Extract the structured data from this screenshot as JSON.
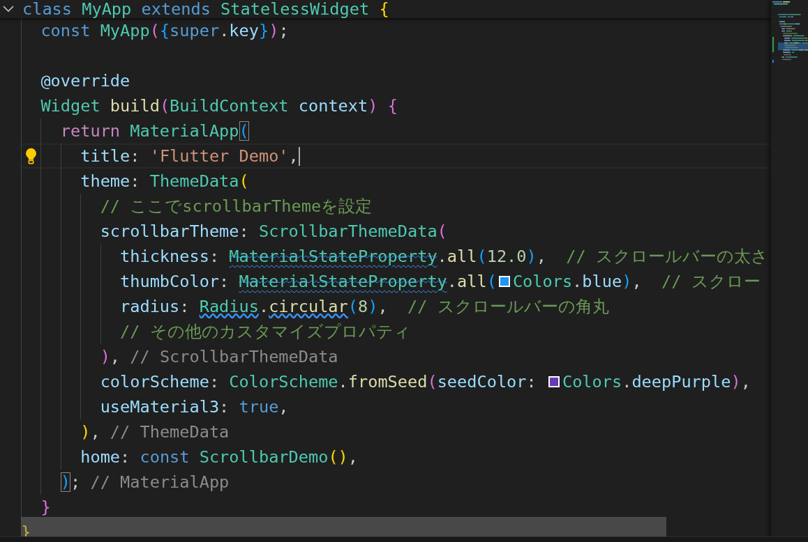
{
  "sticky_line": {
    "expanded": true,
    "tokens": [
      {
        "text": "class ",
        "kind": "kw"
      },
      {
        "text": "MyApp ",
        "kind": "type"
      },
      {
        "text": "extends ",
        "kind": "kw"
      },
      {
        "text": "StatelessWidget ",
        "kind": "type"
      },
      {
        "text": "{",
        "kind": "br1"
      }
    ]
  },
  "lines": [
    {
      "tokens": [
        {
          "text": "const ",
          "kind": "kw"
        },
        {
          "text": "MyApp",
          "kind": "type"
        },
        {
          "text": "(",
          "kind": "br2"
        },
        {
          "text": "{",
          "kind": "br3"
        },
        {
          "text": "super",
          "kind": "kw"
        },
        {
          "text": ".",
          "kind": "punct"
        },
        {
          "text": "key",
          "kind": "var"
        },
        {
          "text": "}",
          "kind": "br3"
        },
        {
          "text": ")",
          "kind": "br2"
        },
        {
          "text": ";",
          "kind": "punct"
        }
      ]
    },
    {
      "kind": "blank"
    },
    {
      "tokens": [
        {
          "text": "@override",
          "kind": "var"
        }
      ]
    },
    {
      "tokens": [
        {
          "text": "Widget ",
          "kind": "type"
        },
        {
          "text": "build",
          "kind": "fn"
        },
        {
          "text": "(",
          "kind": "br2"
        },
        {
          "text": "BuildContext ",
          "kind": "type"
        },
        {
          "text": "context",
          "kind": "var"
        },
        {
          "text": ") ",
          "kind": "br2"
        },
        {
          "text": "{",
          "kind": "br2"
        }
      ],
      "children": [
        {
          "tokens": [
            {
              "text": "return ",
              "kind": "ctl"
            },
            {
              "text": "MaterialApp",
              "kind": "type"
            },
            {
              "text": "(",
              "kind": "br3",
              "matched": true
            }
          ],
          "children": [
            {
              "current": true,
              "lightbulb": true,
              "cursor": true,
              "tokens": [
                {
                  "text": "title",
                  "kind": "var"
                },
                {
                  "text": ": ",
                  "kind": "punct"
                },
                {
                  "text": "'Flutter Demo'",
                  "kind": "str"
                },
                {
                  "text": ",",
                  "kind": "punct"
                }
              ]
            },
            {
              "tokens": [
                {
                  "text": "theme",
                  "kind": "var"
                },
                {
                  "text": ": ",
                  "kind": "punct"
                },
                {
                  "text": "ThemeData",
                  "kind": "type"
                },
                {
                  "text": "(",
                  "kind": "br1"
                }
              ],
              "children": [
                {
                  "tokens": [
                    {
                      "text": "// ここでscrollbarThemeを設定",
                      "kind": "cmt"
                    }
                  ]
                },
                {
                  "tokens": [
                    {
                      "text": "scrollbarTheme",
                      "kind": "var"
                    },
                    {
                      "text": ": ",
                      "kind": "punct"
                    },
                    {
                      "text": "ScrollbarThemeData",
                      "kind": "type"
                    },
                    {
                      "text": "(",
                      "kind": "br2"
                    }
                  ],
                  "children": [
                    {
                      "tokens": [
                        {
                          "text": "thickness",
                          "kind": "var"
                        },
                        {
                          "text": ": ",
                          "kind": "punct"
                        },
                        {
                          "text": "MaterialStateProperty",
                          "kind": "type",
                          "deprecated": true
                        },
                        {
                          "text": ".",
                          "kind": "punct"
                        },
                        {
                          "text": "all",
                          "kind": "fn"
                        },
                        {
                          "text": "(",
                          "kind": "br3"
                        },
                        {
                          "text": "12.0",
                          "kind": "num"
                        },
                        {
                          "text": ")",
                          "kind": "br3"
                        },
                        {
                          "text": ",  ",
                          "kind": "punct"
                        },
                        {
                          "text": "// スクロールバーの太さ",
                          "kind": "cmt"
                        }
                      ]
                    },
                    {
                      "tokens": [
                        {
                          "text": "thumbColor",
                          "kind": "var"
                        },
                        {
                          "text": ": ",
                          "kind": "punct"
                        },
                        {
                          "text": "MaterialStateProperty",
                          "kind": "type",
                          "deprecated": true
                        },
                        {
                          "text": ".",
                          "kind": "punct"
                        },
                        {
                          "text": "all",
                          "kind": "fn"
                        },
                        {
                          "text": "(",
                          "kind": "br3"
                        },
                        {
                          "kind": "swatch",
                          "color": "#2196f3"
                        },
                        {
                          "text": "Colors",
                          "kind": "type"
                        },
                        {
                          "text": ".",
                          "kind": "punct"
                        },
                        {
                          "text": "blue",
                          "kind": "var"
                        },
                        {
                          "text": ")",
                          "kind": "br3"
                        },
                        {
                          "text": ",  ",
                          "kind": "punct"
                        },
                        {
                          "text": "// スクロー",
                          "kind": "cmt"
                        }
                      ]
                    },
                    {
                      "tokens": [
                        {
                          "text": "radius",
                          "kind": "var"
                        },
                        {
                          "text": ": ",
                          "kind": "punct"
                        },
                        {
                          "text": "Radius",
                          "kind": "type",
                          "squiggle": true
                        },
                        {
                          "text": ".",
                          "kind": "punct"
                        },
                        {
                          "text": "circular",
                          "kind": "fn",
                          "squiggle": true
                        },
                        {
                          "text": "(",
                          "kind": "br3"
                        },
                        {
                          "text": "8",
                          "kind": "num"
                        },
                        {
                          "text": ")",
                          "kind": "br3"
                        },
                        {
                          "text": ",  ",
                          "kind": "punct"
                        },
                        {
                          "text": "// スクロールバーの角丸",
                          "kind": "cmt"
                        }
                      ]
                    },
                    {
                      "tokens": [
                        {
                          "text": "// その他のカスタマイズプロパティ",
                          "kind": "cmt"
                        }
                      ]
                    }
                  ]
                },
                {
                  "tokens": [
                    {
                      "text": ")",
                      "kind": "br2"
                    },
                    {
                      "text": ", ",
                      "kind": "punct"
                    },
                    {
                      "text": "// ScrollbarThemeData",
                      "kind": "hint"
                    }
                  ]
                },
                {
                  "tokens": [
                    {
                      "text": "colorScheme",
                      "kind": "var"
                    },
                    {
                      "text": ": ",
                      "kind": "punct"
                    },
                    {
                      "text": "ColorScheme",
                      "kind": "type"
                    },
                    {
                      "text": ".",
                      "kind": "punct"
                    },
                    {
                      "text": "fromSeed",
                      "kind": "fn"
                    },
                    {
                      "text": "(",
                      "kind": "br2"
                    },
                    {
                      "text": "seedColor",
                      "kind": "var"
                    },
                    {
                      "text": ": ",
                      "kind": "punct"
                    },
                    {
                      "kind": "swatch",
                      "color": "#673ab7"
                    },
                    {
                      "text": "Colors",
                      "kind": "type"
                    },
                    {
                      "text": ".",
                      "kind": "punct"
                    },
                    {
                      "text": "deepPurple",
                      "kind": "var"
                    },
                    {
                      "text": ")",
                      "kind": "br2"
                    },
                    {
                      "text": ",",
                      "kind": "punct"
                    }
                  ]
                },
                {
                  "tokens": [
                    {
                      "text": "useMaterial3",
                      "kind": "var"
                    },
                    {
                      "text": ": ",
                      "kind": "punct"
                    },
                    {
                      "text": "true",
                      "kind": "kw"
                    },
                    {
                      "text": ",",
                      "kind": "punct"
                    }
                  ]
                }
              ]
            },
            {
              "tokens": [
                {
                  "text": ")",
                  "kind": "br1"
                },
                {
                  "text": ", ",
                  "kind": "punct"
                },
                {
                  "text": "// ThemeData",
                  "kind": "hint"
                }
              ]
            },
            {
              "tokens": [
                {
                  "text": "home",
                  "kind": "var"
                },
                {
                  "text": ": ",
                  "kind": "punct"
                },
                {
                  "text": "const ",
                  "kind": "kw"
                },
                {
                  "text": "ScrollbarDemo",
                  "kind": "type"
                },
                {
                  "text": "(",
                  "kind": "br1"
                },
                {
                  "text": ")",
                  "kind": "br1"
                },
                {
                  "text": ",",
                  "kind": "punct"
                }
              ]
            }
          ]
        },
        {
          "tokens": [
            {
              "text": ")",
              "kind": "br3",
              "matched": true
            },
            {
              "text": "; ",
              "kind": "punct"
            },
            {
              "text": "// MaterialApp",
              "kind": "hint"
            }
          ]
        }
      ]
    },
    {
      "tokens": [
        {
          "text": "}",
          "kind": "br2"
        }
      ]
    }
  ],
  "closing_line": {
    "tokens": [
      {
        "text": "}",
        "kind": "br1"
      }
    ]
  }
}
